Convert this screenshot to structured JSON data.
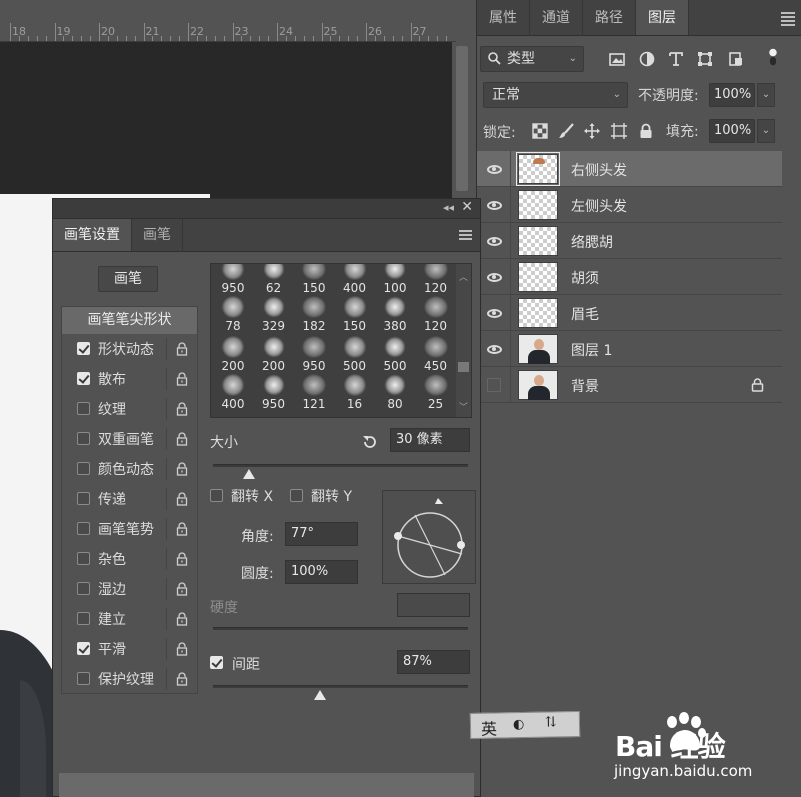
{
  "ruler": {
    "labels": [
      "18",
      "19",
      "20",
      "21",
      "22",
      "23",
      "24",
      "25",
      "26",
      "27"
    ]
  },
  "layers_panel": {
    "tabs": [
      {
        "label": "属性",
        "active": false
      },
      {
        "label": "通道",
        "active": false
      },
      {
        "label": "路径",
        "active": false
      },
      {
        "label": "图层",
        "active": true
      }
    ],
    "filter": {
      "label": "类型",
      "icon": "search-icon"
    },
    "filter_icons": [
      "image-filter-icon",
      "adjustment-filter-icon",
      "type-filter-icon",
      "shape-filter-icon",
      "smart-object-filter-icon",
      "filter-toggle-icon"
    ],
    "blend_mode": "正常",
    "opacity_label": "不透明度:",
    "opacity_value": "100%",
    "lock_label": "锁定:",
    "lock_icons": [
      "lock-transparent-icon",
      "lock-image-icon",
      "lock-position-icon",
      "lock-artboard-icon",
      "lock-all-icon"
    ],
    "fill_label": "填充:",
    "fill_value": "100%",
    "layers": [
      {
        "name": "右侧头发",
        "visible": true,
        "selected": true,
        "thumb": "transparent-hair",
        "locked": false
      },
      {
        "name": "左侧头发",
        "visible": true,
        "selected": false,
        "thumb": "transparent",
        "locked": false
      },
      {
        "name": "络腮胡",
        "visible": true,
        "selected": false,
        "thumb": "transparent",
        "locked": false
      },
      {
        "name": "胡须",
        "visible": true,
        "selected": false,
        "thumb": "transparent",
        "locked": false
      },
      {
        "name": "眉毛",
        "visible": true,
        "selected": false,
        "thumb": "transparent",
        "locked": false
      },
      {
        "name": "图层 1",
        "visible": true,
        "selected": false,
        "thumb": "photo",
        "locked": false
      },
      {
        "name": "背景",
        "visible": false,
        "selected": false,
        "thumb": "photo",
        "locked": true
      }
    ]
  },
  "brush_panel": {
    "tabs": [
      {
        "label": "画笔设置",
        "active": true
      },
      {
        "label": "画笔",
        "active": false
      }
    ],
    "brush_button": "画笔",
    "tip_shape_label": "画笔笔尖形状",
    "options": [
      {
        "label": "形状动态",
        "checked": true
      },
      {
        "label": "散布",
        "checked": true
      },
      {
        "label": "纹理",
        "checked": false
      },
      {
        "label": "双重画笔",
        "checked": false
      },
      {
        "label": "颜色动态",
        "checked": false
      },
      {
        "label": "传递",
        "checked": false
      },
      {
        "label": "画笔笔势",
        "checked": false
      },
      {
        "label": "杂色",
        "checked": false
      },
      {
        "label": "湿边",
        "checked": false
      },
      {
        "label": "建立",
        "checked": false
      },
      {
        "label": "平滑",
        "checked": true
      },
      {
        "label": "保护纹理",
        "checked": false
      }
    ],
    "presets": [
      "950",
      "62",
      "150",
      "400",
      "100",
      "120",
      "78",
      "329",
      "182",
      "150",
      "380",
      "120",
      "200",
      "200",
      "950",
      "500",
      "500",
      "450",
      "400",
      "950",
      "121",
      "16",
      "80",
      "25"
    ],
    "size_label": "大小",
    "size_value": "30 像素",
    "size_fraction": 0.14,
    "flip_x_label": "翻转 X",
    "flip_y_label": "翻转 Y",
    "angle_label": "角度:",
    "angle_value": "77°",
    "roundness_label": "圆度:",
    "roundness_value": "100%",
    "hardness_label": "硬度",
    "spacing_label": "间距",
    "spacing_checked": true,
    "spacing_value": "87%",
    "spacing_fraction": 0.42
  },
  "watermark": {
    "ime_chars": [
      "英",
      "🌙",
      "⚡"
    ],
    "brand": "Bai  经验",
    "url": "jingyan.baidu.com"
  }
}
